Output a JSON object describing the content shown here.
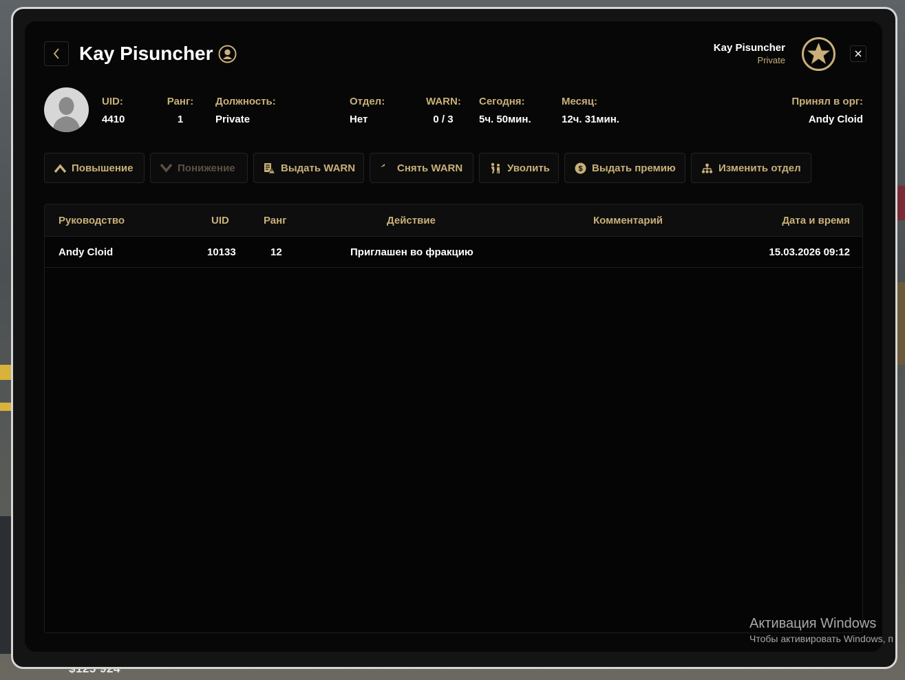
{
  "profile": {
    "name": "Kay Pisuncher"
  },
  "current_user": {
    "name": "Kay Pisuncher",
    "rank": "Private"
  },
  "stats": [
    {
      "label": "UID:",
      "value": "4410"
    },
    {
      "label": "Ранг:",
      "value": "1"
    },
    {
      "label": "Должность:",
      "value": "Private"
    },
    {
      "label": "Отдел:",
      "value": "Нет"
    },
    {
      "label": "WARN:",
      "value": "0 / 3"
    },
    {
      "label": "Сегодня:",
      "value": "5ч. 50мин."
    },
    {
      "label": "Месяц:",
      "value": "12ч. 31мин."
    },
    {
      "label": "Принял в орг:",
      "value": "Andy Cloid"
    }
  ],
  "actions": [
    {
      "label": "Повышение",
      "icon": "chevron-up-icon",
      "enabled": true
    },
    {
      "label": "Понижение",
      "icon": "chevron-down-icon",
      "enabled": false
    },
    {
      "label": "Выдать WARN",
      "icon": "warn-document-icon",
      "enabled": true
    },
    {
      "label": "Снять WARN",
      "icon": "undo-arrow-icon",
      "enabled": true
    },
    {
      "label": "Уволить",
      "icon": "kick-person-icon",
      "enabled": true
    },
    {
      "label": "Выдать премию",
      "icon": "dollar-coin-icon",
      "enabled": true
    },
    {
      "label": "Изменить отдел",
      "icon": "hierarchy-icon",
      "enabled": true
    }
  ],
  "table": {
    "headers": [
      "Руководство",
      "UID",
      "Ранг",
      "Действие",
      "Комментарий",
      "Дата и время"
    ],
    "rows": [
      [
        "Andy Cloid",
        "10133",
        "12",
        "Приглашен во фракцию",
        "",
        "15.03.2026 09:12"
      ]
    ]
  },
  "hud": {
    "money": "$125 924"
  },
  "windows_watermark": {
    "title": "Активация Windows",
    "subtitle": "Чтобы активировать Windows, п"
  },
  "colors": {
    "accent": "#c9b079",
    "panel_bg": "#070707",
    "text": "#ffffff"
  }
}
